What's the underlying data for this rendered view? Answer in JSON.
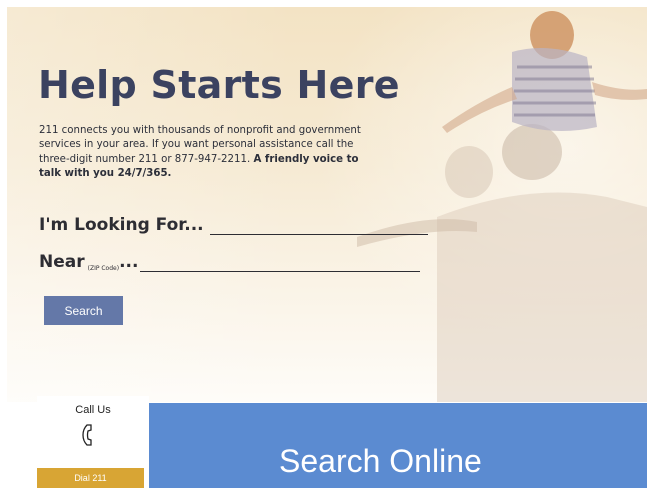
{
  "hero": {
    "headline": "Help Starts Here",
    "intro": "211 connects you with thousands of nonprofit and government services in your area. If you want personal assistance call the three-digit number 211 or 877-947-2211.",
    "intro_strong": "A friendly voice to talk with you 24/7/365."
  },
  "search_form": {
    "looking_for_label": "I'm Looking For...",
    "looking_for_value": "",
    "near_label": "Near",
    "zip_note": "(ZIP Code)",
    "near_suffix": "...",
    "near_value": "",
    "search_button": "Search"
  },
  "call_panel": {
    "label": "Call Us",
    "icon": "phone-icon",
    "dial_button": "Dial 211"
  },
  "online_panel": {
    "label": "Search Online"
  },
  "colors": {
    "headline": "#3b4260",
    "search_button": "#6478a8",
    "dial_button": "#d8a534",
    "online_panel": "#5b8bd1"
  }
}
